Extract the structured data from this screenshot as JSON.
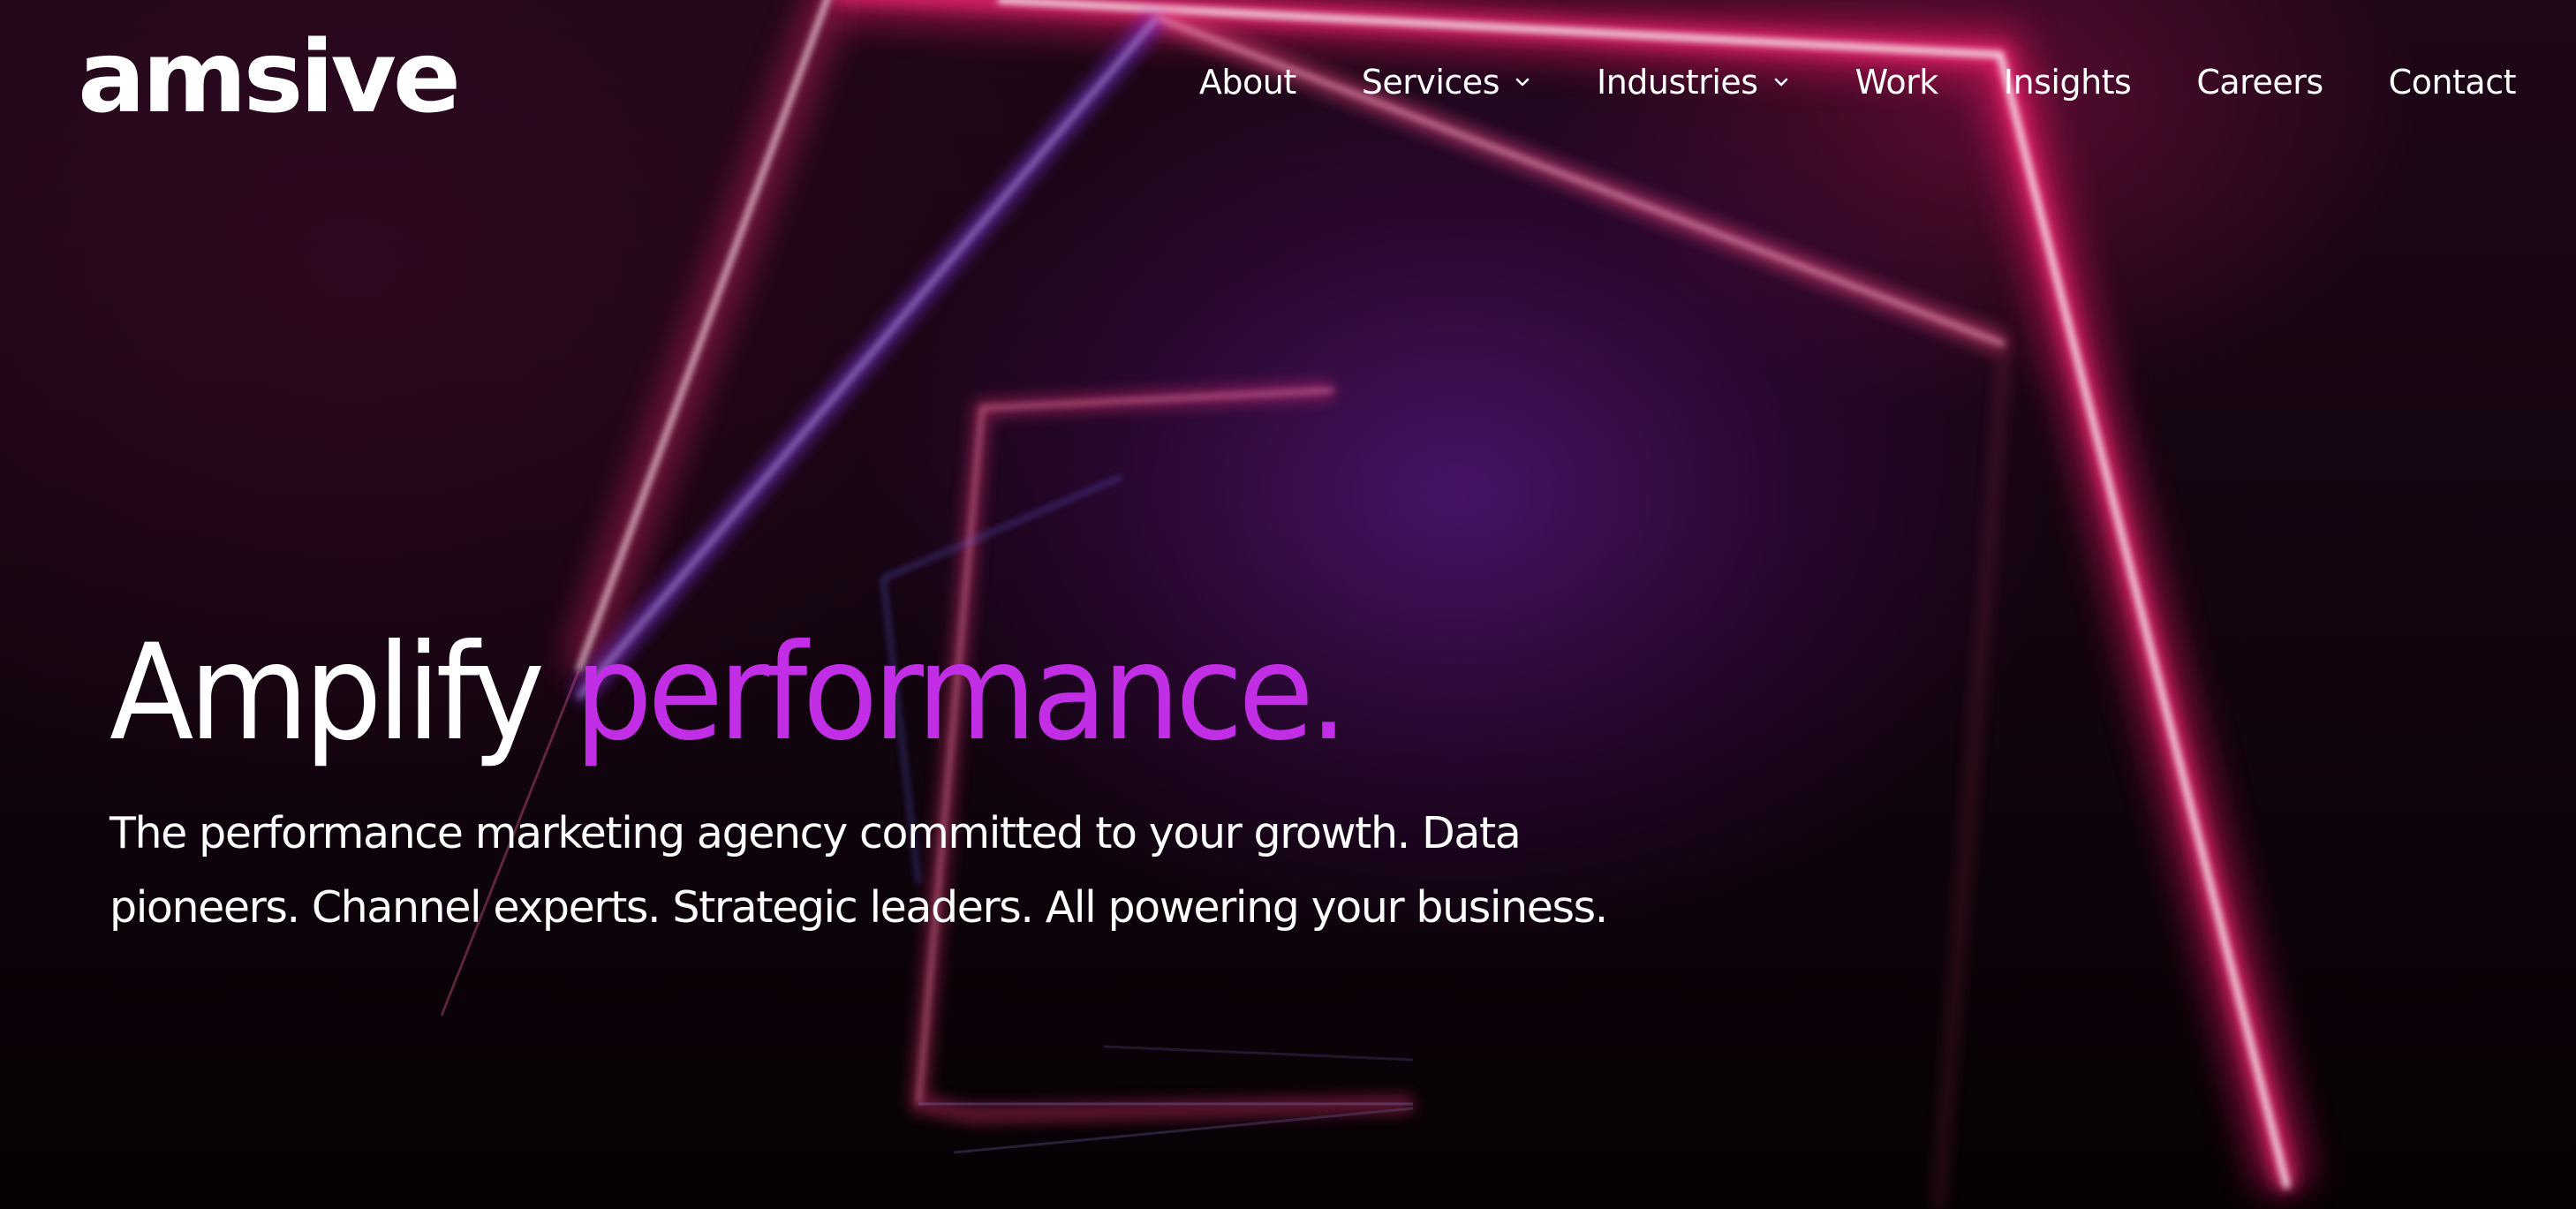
{
  "brand": {
    "logo_text": "amsive"
  },
  "nav": {
    "items": [
      {
        "label": "About",
        "has_dropdown": false
      },
      {
        "label": "Services",
        "has_dropdown": true
      },
      {
        "label": "Industries",
        "has_dropdown": true
      },
      {
        "label": "Work",
        "has_dropdown": false
      },
      {
        "label": "Insights",
        "has_dropdown": false
      },
      {
        "label": "Careers",
        "has_dropdown": false
      },
      {
        "label": "Contact",
        "has_dropdown": false
      }
    ]
  },
  "hero": {
    "headline_part1": "Amplify",
    "headline_part2": "performance.",
    "subheadline": "The performance marketing agency committed to your growth. Data pioneers. Channel experts. Strategic leaders. All powering your business."
  },
  "colors": {
    "headline_accent": "#c22ee6",
    "neon_pink": "#ff1f6e",
    "neon_purple": "#8a3cff",
    "background": "#12040f"
  },
  "icons": {
    "dropdown": "chevron-down-icon"
  }
}
